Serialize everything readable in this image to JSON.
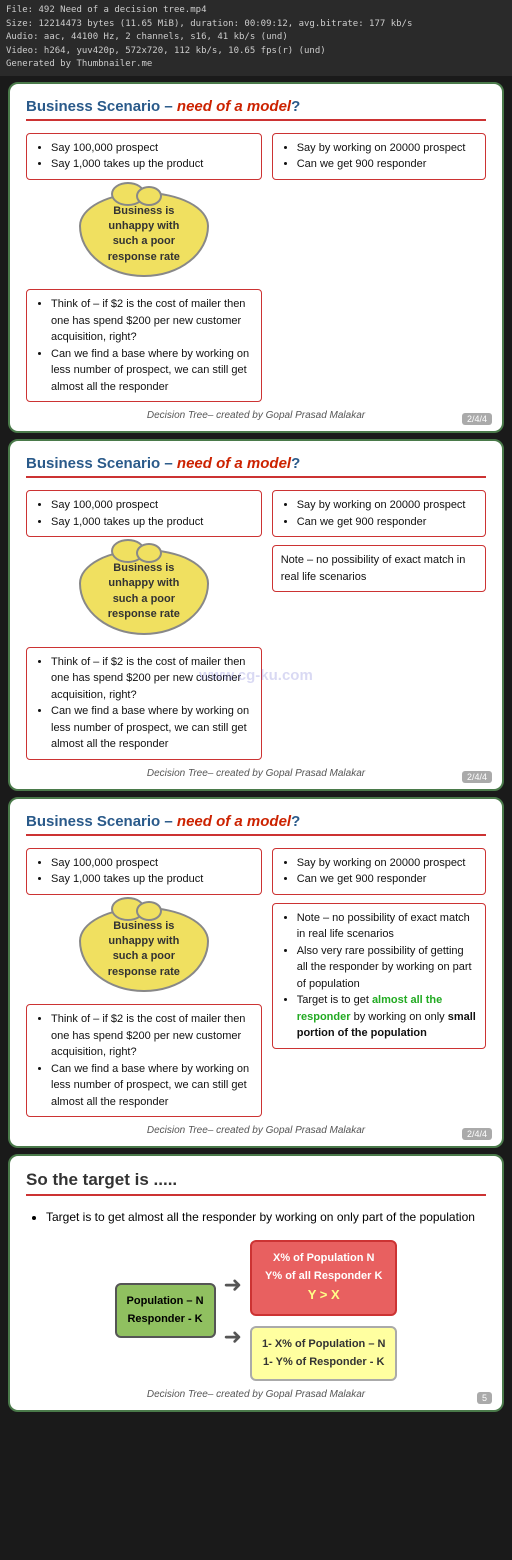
{
  "file_info": {
    "line1": "File: 492 Need of a decision tree.mp4",
    "line2": "Size: 12214473 bytes (11.65 MiB), duration: 00:09:12, avg.bitrate: 177 kb/s",
    "line3": "Audio: aac, 44100 Hz, 2 channels, s16, 41 kb/s (und)",
    "line4": "Video: h264, yuv420p, 572x720, 112 kb/s, 10.65 fps(r) (und)",
    "line5": "Generated by Thumbnailer.me"
  },
  "slide1": {
    "title_normal": "Business Scenario – ",
    "title_highlight": "need of a model",
    "title_end": "?",
    "bullet1_items": [
      "Say 100,000 prospect",
      "Say 1,000 takes up the product"
    ],
    "cloud_text": "Business is unhappy with such a poor response rate",
    "right_bullet1_items": [
      "Say by working on 20000 prospect",
      "Can we get 900 responder"
    ],
    "left_bullet2_items": [
      "Think of – if $2 is the cost of mailer then one has spend $200 per new customer acquisition, right?",
      "Can we find a base where by working on less number of prospect, we can still get almost all the responder"
    ],
    "footer": "Decision Tree– created by Gopal Prasad Malakar",
    "slide_num": "2/4/4"
  },
  "slide2": {
    "title_normal": "Business Scenario – ",
    "title_highlight": "need of a model",
    "title_end": "?",
    "bullet1_items": [
      "Say 100,000 prospect",
      "Say 1,000 takes up the product"
    ],
    "cloud_text": "Business is unhappy with such a poor response rate",
    "right_bullet1_items": [
      "Say by working on 20000 prospect",
      "Can we get 900 responder"
    ],
    "note_text": "Note – no possibility of exact match in real life scenarios",
    "left_bullet2_items": [
      "Think of – if $2 is the cost of mailer then one has spend $200 per new customer acquisition, right?",
      "Can we find a base where by working on less number of prospect, we can still get almost all the responder"
    ],
    "watermark": "www.cg-ku.com",
    "footer": "Decision Tree– created by Gopal Prasad Malakar",
    "slide_num": "2/4/4"
  },
  "slide3": {
    "title_normal": "Business Scenario – ",
    "title_highlight": "need of a model",
    "title_end": "?",
    "bullet1_items": [
      "Say 100,000 prospect",
      "Say 1,000 takes up the product"
    ],
    "cloud_text": "Business is unhappy with such a poor response rate",
    "right_bullet1_items": [
      "Say by working on 20000 prospect",
      "Can we get 900 responder"
    ],
    "note_items": [
      "Note – no possibility of exact match in real life scenarios",
      "Also very rare possibility of getting all the responder by working on part of population",
      "Target is to get almost all the responder by working on only small portion of the population"
    ],
    "note_green_phrase": "almost all the responder",
    "note_bold_phrase": "small portion of the population",
    "left_bullet2_items": [
      "Think of – if $2 is the cost of mailer then one has spend $200 per new customer acquisition, right?",
      "Can we find a base where by working on less number of prospect, we can still get almost all the responder"
    ],
    "footer": "Decision Tree– created by Gopal Prasad Malakar",
    "slide_num": "2/4/4"
  },
  "slide4": {
    "title": "So the target is .....",
    "bullet": "Target is to get almost all the responder by working on only part of the population",
    "pop_box_line1": "Population – N",
    "pop_box_line2": "Responder - K",
    "result_red_line1": "X% of  Population N",
    "result_red_line2": "Y% of all Responder K",
    "result_red_highlight": "Y > X",
    "result_yellow_line1": "1- X% of Population – N",
    "result_yellow_line2": "1- Y% of Responder - K",
    "footer": "Decision Tree– created by Gopal Prasad Malakar",
    "slide_num": "5"
  }
}
